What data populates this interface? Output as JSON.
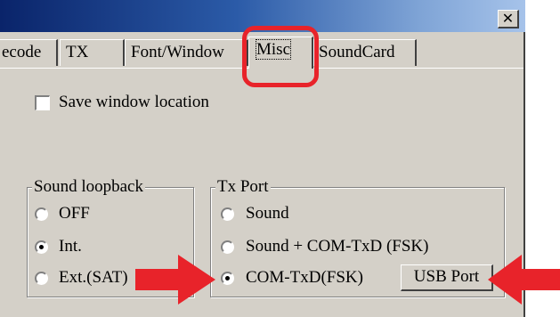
{
  "window": {
    "close_glyph": "✖"
  },
  "tabs": [
    {
      "label": "ecode",
      "active": false
    },
    {
      "label": "TX",
      "active": false
    },
    {
      "label": "Font/Window",
      "active": false
    },
    {
      "label": "Misc",
      "active": true
    },
    {
      "label": "SoundCard",
      "active": false
    }
  ],
  "misc": {
    "save_window_location": {
      "label": "Save window location",
      "checked": false
    },
    "sound_loopback": {
      "title": "Sound loopback",
      "options": [
        {
          "label": "OFF",
          "checked": false
        },
        {
          "label": "Int.",
          "checked": true
        },
        {
          "label": "Ext.(SAT)",
          "checked": false
        }
      ]
    },
    "tx_port": {
      "title": "Tx Port",
      "options": [
        {
          "label": "Sound",
          "checked": false
        },
        {
          "label": "Sound + COM-TxD (FSK)",
          "checked": false
        },
        {
          "label": "COM-TxD(FSK)",
          "checked": true
        }
      ],
      "usb_port_button": "USB Port"
    }
  },
  "annotations": {
    "color": "#e8232a"
  }
}
